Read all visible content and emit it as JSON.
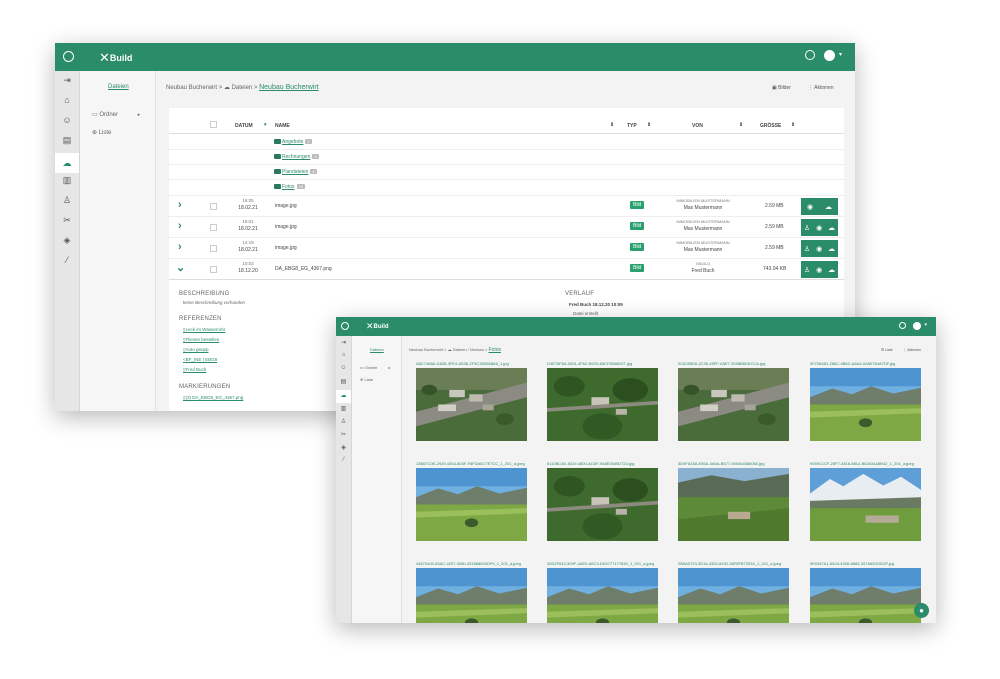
{
  "app": {
    "name": "Build"
  },
  "back_window": {
    "tab_files": "Dateien",
    "folder_tree": [
      {
        "label": "Ordner"
      },
      {
        "label": "Liste"
      }
    ],
    "breadcrumb": {
      "project": "Neubau Bucherwirt",
      "sep1": ">",
      "files": "Dateien",
      "sep2": ">",
      "current": "Neubau Bucherwirt"
    },
    "actions": {
      "images": "Bilder",
      "actions": "Aktionen"
    },
    "table": {
      "headers": {
        "date": "DATUM",
        "name": "NAME",
        "type": "TYP",
        "from": "VON",
        "size": "GRÖSSE"
      },
      "folders": [
        {
          "name": "Angebote",
          "count": "2"
        },
        {
          "name": "Rechnungen",
          "count": "3"
        },
        {
          "name": "Plandateien",
          "count": "4"
        },
        {
          "name": "Fotos",
          "count": "10"
        }
      ],
      "files": [
        {
          "time": "16:05",
          "date": "18.02.21",
          "name": "image.jpg",
          "type": "Bild",
          "company": "IMMOBILIEN MUSTERMANN",
          "person": "Max Mustermann",
          "size": "2.59 MB"
        },
        {
          "time": "16:01",
          "date": "18.02.21",
          "name": "image.jpg",
          "type": "Bild",
          "company": "IMMOBILIEN MUSTERMANN",
          "person": "Max Mustermann",
          "size": "2.59 MB"
        },
        {
          "time": "14:19",
          "date": "18.02.21",
          "name": "image.jpg",
          "type": "Bild",
          "company": "IMMOBILIEN MUSTERMANN",
          "person": "Max Mustermann",
          "size": "2.59 MB"
        },
        {
          "time": "10:03",
          "date": "18.12.20",
          "name": "DA_EBG8_EG_4367.png",
          "type": "Bild",
          "company": "XBUILD",
          "person": "Fred Buch",
          "size": "743.04 KB"
        }
      ]
    },
    "detail": {
      "desc_title": "BESCHREIBUNG",
      "desc_text": "keine Beschreibung vorhanden",
      "refs_title": "REFERENZEN",
      "refs": [
        "Leck im Wasserrohr",
        "Fliesen bestellen",
        "Auto geupp",
        "BF_INE | EBG8",
        "Fred Buch"
      ],
      "marks_title": "MARKIERUNGEN",
      "marks": [
        "(3) DA_EBG8_EG_4367.png"
      ],
      "history_title": "VERLAUF",
      "history_entry": "Fred Buch  18.12.20 10:09",
      "history_action": "Datei erstellt"
    }
  },
  "front_window": {
    "tab_files": "Dateien",
    "folder_tree": [
      {
        "label": "Ordner"
      },
      {
        "label": "Liste"
      }
    ],
    "breadcrumb": {
      "project": "Neubau Bucherwirt",
      "sep1": ">",
      "files": "Dateien / Neubau",
      "sep2": ">",
      "current": "Fotos"
    },
    "actions": {
      "list": "Liste",
      "actions": "Aktionen"
    },
    "photos": [
      {
        "name": "A8C7468A-D826-4FE4-8D38-2F3C1B5568A6_1.jpg",
        "scene": "aerial-village"
      },
      {
        "name": "D4E76F6A-2691-4F62-B925-4BCF8548D07.jpg",
        "scene": "aerial-trees"
      },
      {
        "name": "0C6259D6-2C35-49FF-A5E7-3098B6DECCA.jpg",
        "scene": "aerial-village"
      },
      {
        "name": "90755A81-286C-4B6C-A6A4-0A60784A7DF.jpg",
        "scene": "valley-sky"
      },
      {
        "name": "13B57C0E-2929-4304-803F-F8FDA5C7E7CC_1_201_a.jpeg",
        "scene": "valley-sky"
      },
      {
        "name": "6110BC4D-8319-4800-AC6F-9A8E0545D724.jpg",
        "scene": "aerial-trees"
      },
      {
        "name": "3D9F62A8-E56A-4A6A-B577-905464586060.jpg",
        "scene": "green-hills"
      },
      {
        "name": "9059C1CF-25F7-4818-8814-B62634A8B42_1_201_a.jpeg",
        "scene": "snowy-valley"
      },
      {
        "name": "44670400-65AC-4207-905b-331668540DF9_1_201_a.jpeg",
        "scene": "valley-sky"
      },
      {
        "name": "30D2F643-309F-4AE0-A6C3-DA5777177830_1_201_a.jpeg",
        "scene": "valley-sky"
      },
      {
        "name": "2B5A0723-3D16-4352-8432-38F8FB72534_1_201_a.jpeg",
        "scene": "valley-sky"
      },
      {
        "name": "9E0367A1-6624-4908-8683-347A6531002F.jpg",
        "scene": "valley-sky"
      }
    ]
  },
  "colors": {
    "brand": "#2a8c69",
    "badge": "#2aa06f"
  },
  "icons": {
    "menu": "menu-icon",
    "search": "search-icon",
    "avatar": "avatar-icon",
    "chat": "chat-icon"
  }
}
